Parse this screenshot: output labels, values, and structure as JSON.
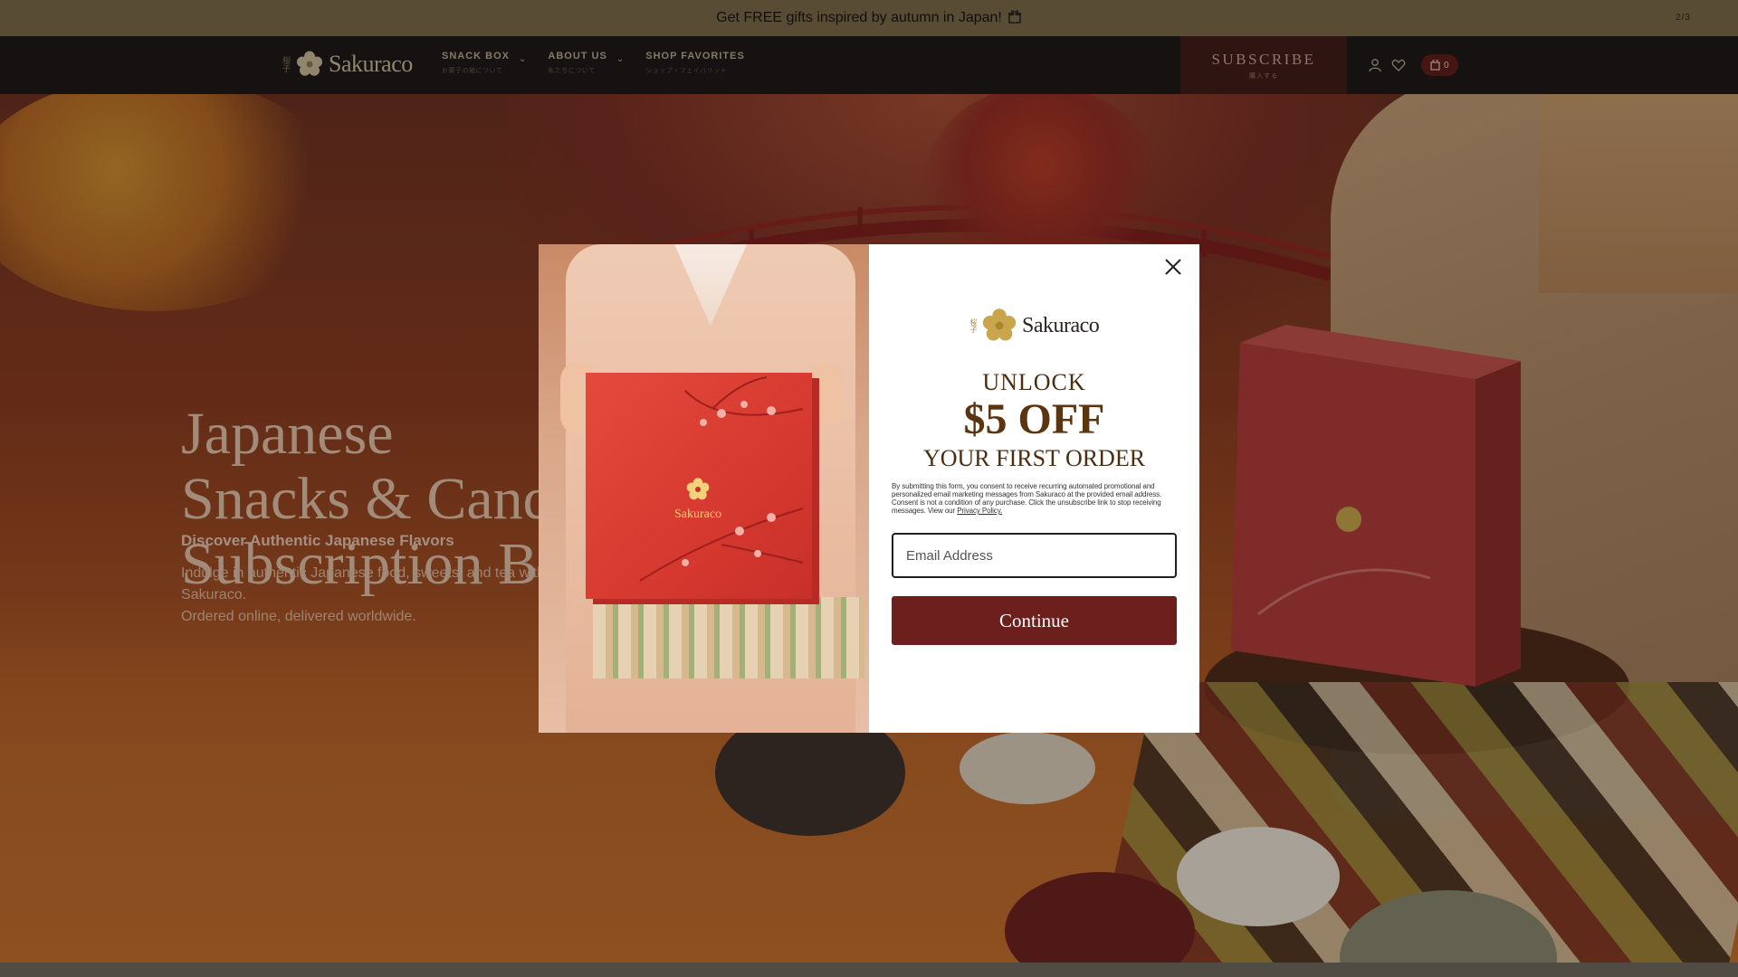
{
  "announcement": {
    "text": "Get FREE gifts inspired by autumn in Japan!",
    "counter": "2/3"
  },
  "header": {
    "logo_text": "Sakuraco",
    "logo_kanji": "桜子",
    "nav": [
      {
        "label": "SNACK BOX",
        "sub": "お菓子の箱について"
      },
      {
        "label": "ABOUT US",
        "sub": "私たちについて"
      },
      {
        "label": "SHOP FAVORITES",
        "sub": "ショップ・フェイバリット"
      }
    ],
    "subscribe_label": "SUBSCRIBE",
    "subscribe_sub": "購入する",
    "cart_count": "0"
  },
  "hero": {
    "title_lines": [
      "Japanese",
      "Snacks & Candy",
      "Subscription Box"
    ],
    "subtitle": "Discover Authentic Japanese Flavors",
    "desc_line1": "Indulge in authentic Japanese food, sweets, and tea with Sakuraco.",
    "desc_line2": "Ordered online, delivered worldwide."
  },
  "modal": {
    "logo_text": "Sakuraco",
    "logo_kanji": "桜子",
    "box_logo_text": "Sakuraco",
    "headline_1": "UNLOCK",
    "headline_2": "$5 OFF",
    "headline_3": "YOUR FIRST ORDER",
    "consent": "By submitting this form, you consent to receive recurring automated promotional and personalized email marketing messages from Sakuraco at the provided email address. Consent is not a condition of any purchase. Click the unsubscribe link to stop receiving messages. View our",
    "privacy_link": "Privacy Policy.",
    "email_placeholder": "Email Address",
    "continue_label": "Continue"
  },
  "colors": {
    "brand_dark_red": "#6d1f1d",
    "header_bg": "#171615",
    "announcement_bg": "#7a6b4a",
    "gold": "#cdbf9e"
  },
  "icons": [
    "gift-icon",
    "sakura-flower-icon",
    "chevron-down-icon",
    "user-icon",
    "heart-icon",
    "bag-icon",
    "close-icon"
  ]
}
